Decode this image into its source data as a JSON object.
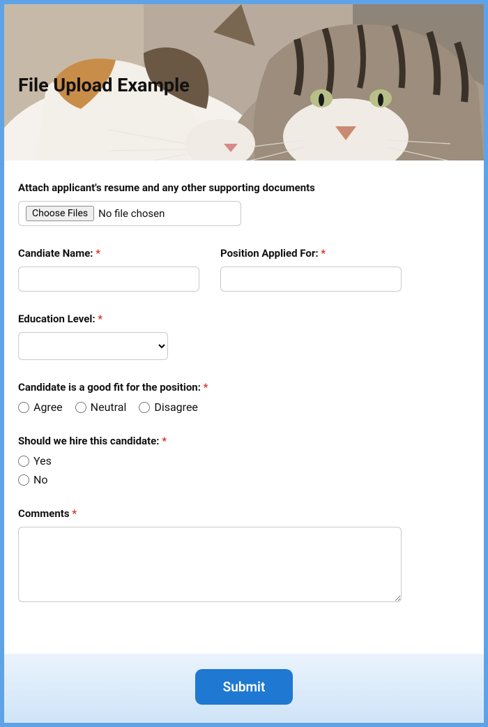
{
  "header": {
    "title": "File Upload Example"
  },
  "upload": {
    "label": "Attach applicant's resume and any other supporting documents",
    "button": "Choose Files",
    "status": "No file chosen"
  },
  "name": {
    "label": "Candiate Name: ",
    "value": ""
  },
  "position": {
    "label": "Position Applied For: ",
    "value": ""
  },
  "education": {
    "label": "Education Level: ",
    "value": ""
  },
  "fit": {
    "label": "Candidate is a good fit for the position: ",
    "options": {
      "agree": "Agree",
      "neutral": "Neutral",
      "disagree": "Disagree"
    }
  },
  "hire": {
    "label": "Should we hire this candidate: ",
    "options": {
      "yes": "Yes",
      "no": "No"
    }
  },
  "comments": {
    "label": "Comments ",
    "value": ""
  },
  "submit": {
    "label": "Submit"
  },
  "asterisk": "*"
}
